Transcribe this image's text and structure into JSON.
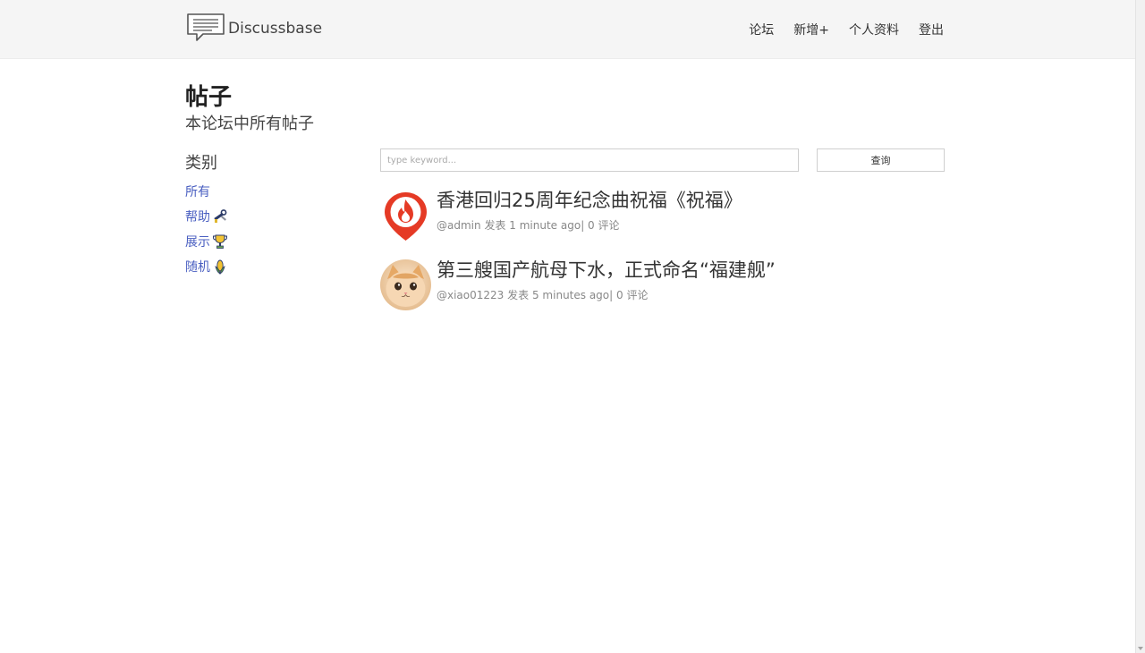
{
  "brand": {
    "name": "Discussbase",
    "icon": "chat-bubble-logo"
  },
  "nav": {
    "forum": "论坛",
    "new": "新增+",
    "profile": "个人资料",
    "logout": "登出"
  },
  "page": {
    "title": "帖子",
    "subtitle": "本论坛中所有帖子"
  },
  "sidebar": {
    "heading": "类别",
    "categories": [
      {
        "label": "所有",
        "icon": ""
      },
      {
        "label": "帮助",
        "icon": "tool-icon"
      },
      {
        "label": "展示",
        "icon": "trophy-icon"
      },
      {
        "label": "随机",
        "icon": "corn-icon"
      }
    ]
  },
  "search": {
    "placeholder": "type keyword...",
    "button": "查询"
  },
  "posts": [
    {
      "title": "香港回归25周年纪念曲祝福《祝福》",
      "author": "@admin",
      "action": "发表",
      "time": "1 minute ago",
      "comments": "| 0 评论",
      "avatar": "fire-pin-avatar"
    },
    {
      "title": "第三艘国产航母下水，正式命名“福建舰”",
      "author": "@xiao01223",
      "action": "发表",
      "time": "5 minutes ago",
      "comments": "| 0 评论",
      "avatar": "cat-avatar"
    }
  ],
  "colors": {
    "header_bg": "#f5f5f5",
    "link": "#4a5fc1",
    "fire_red": "#e53a25"
  }
}
